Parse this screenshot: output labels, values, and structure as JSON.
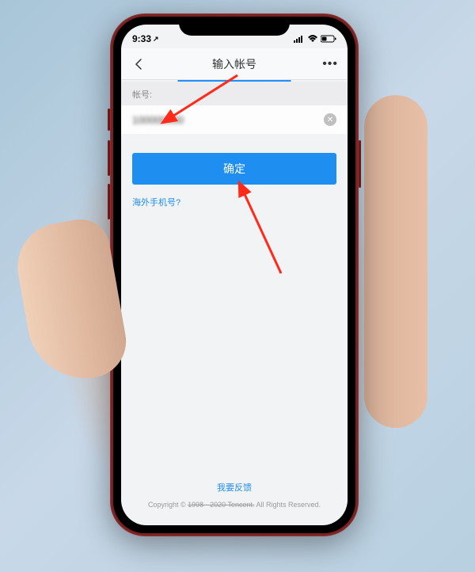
{
  "status": {
    "time": "9:33",
    "locator_icon": "↗"
  },
  "nav": {
    "title": "输入帐号",
    "more": "•••"
  },
  "form": {
    "account_label": "帐号:",
    "account_value": "100000000",
    "clear_icon": "✕"
  },
  "actions": {
    "confirm": "确定",
    "overseas_link": "海外手机号?"
  },
  "footer": {
    "feedback": "我要反馈",
    "copyright_prefix": "Copyright © ",
    "copyright_years": "1998 - 2020 Tencent.",
    "copyright_suffix": "All Rights Reserved."
  }
}
